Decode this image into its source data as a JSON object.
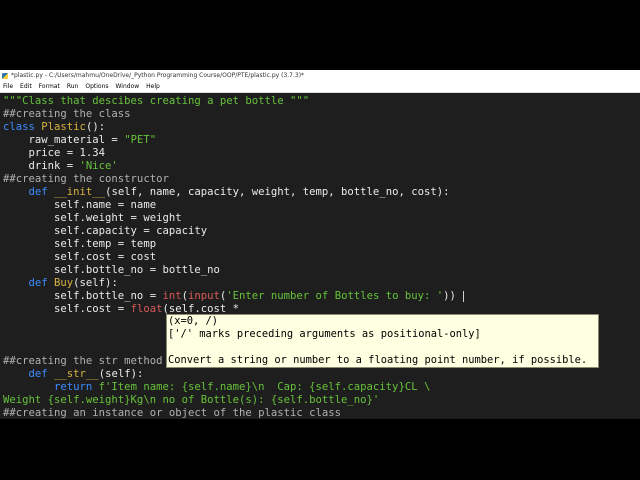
{
  "window": {
    "title": "*plastic.py - C:/Users/mahmu/OneDrive/_Python Programming Course/OOP/PTE/plastic.py (3.7.3)*"
  },
  "menu": [
    "File",
    "Edit",
    "Format",
    "Run",
    "Options",
    "Window",
    "Help"
  ],
  "code": {
    "l1": "\"\"\"Class that descibes creating a pet bottle \"\"\"",
    "l2": "##creating the class",
    "l3_kw": "class",
    "l3_name": "Plastic",
    "l3_rest": "():",
    "l4_a": "    raw_material = ",
    "l4_s": "\"PET\"",
    "l5": "    price = 1.34",
    "l6_a": "    drink = ",
    "l6_s": "'Nice'",
    "l7": "##creating the constructor",
    "l8_kw": "    def",
    "l8_name": " __init__",
    "l8_rest": "(self, name, capacity, weight, temp, bottle_no, cost):",
    "l9": "        self.name = name",
    "l10": "        self.weight = weight",
    "l11": "        self.capacity = capacity",
    "l12": "        self.temp = temp",
    "l13": "        self.cost = cost",
    "l14": "        self.bottle_no = bottle_no",
    "l15_kw": "    def",
    "l15_name": " Buy",
    "l15_rest": "(self):",
    "l16_a": "        self.bottle_no = ",
    "l16_b1": "int",
    "l16_b": "(",
    "l16_b2": "input",
    "l16_c": "(",
    "l16_s": "'Enter number of Bottles to buy: '",
    "l16_d": "))",
    "l17_a": "        self.cost = ",
    "l17_b": "float",
    "l17_c": "(self.cost *",
    "l18": "##creating the str method",
    "l19_kw": "    def",
    "l19_name": " __str__",
    "l19_rest": "(self):",
    "l20_kw": "        return",
    "l20_s": " f'Item name: {self.name}\\n  Cap: {self.capacity}CL \\",
    "l21_s": "Weight {self.weight}Kg\\n no of Bottle(s): {self.bottle_no}'",
    "l22": "##creating an instance or object of the plastic class"
  },
  "calltip": {
    "line1": "(x=0, /)",
    "line2": "['/' marks preceding arguments as positional-only]",
    "line3": "",
    "line4": "Convert a string or number to a floating point number, if possible."
  },
  "colors": {
    "keyword": "#3c8cff",
    "string": "#67c23a",
    "comment": "#b0b0b0",
    "definition": "#d9b341",
    "builtin": "#d85a5a",
    "background": "#1e1e1e",
    "calltip_bg": "#ffffe1"
  }
}
